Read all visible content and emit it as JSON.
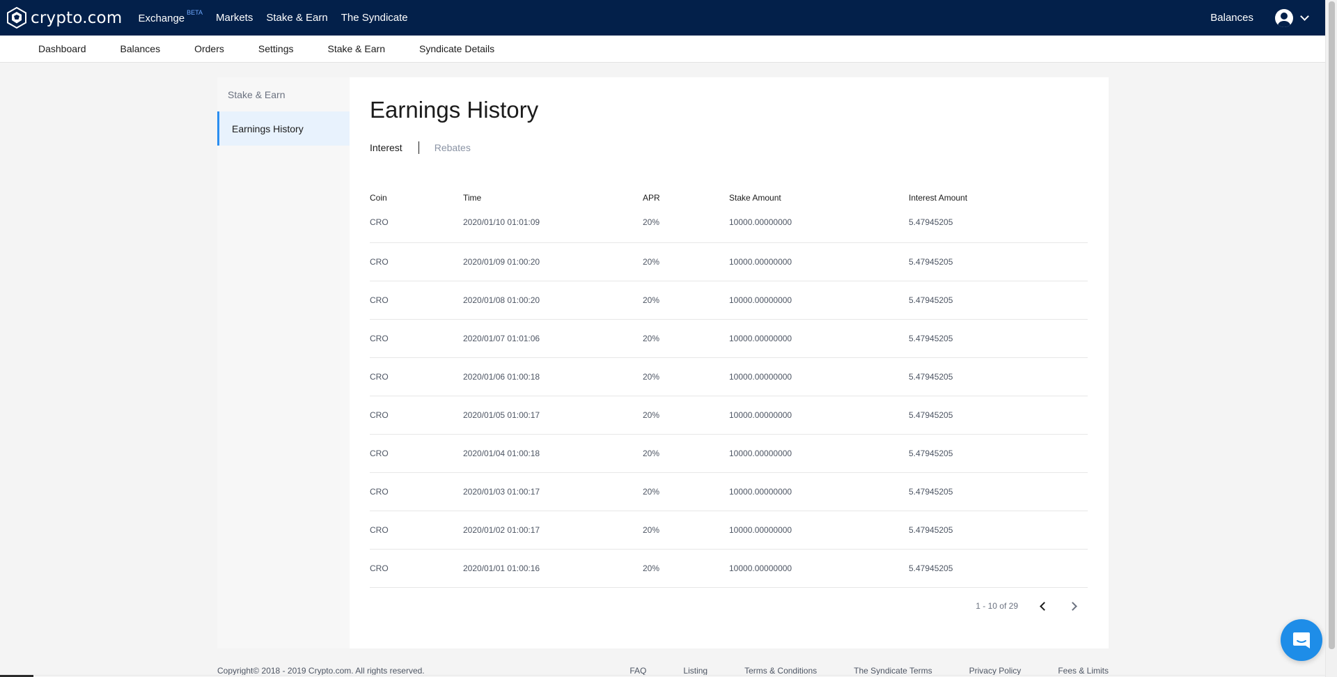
{
  "topbar": {
    "logo_text": "crypto.com",
    "nav": [
      {
        "label": "Exchange",
        "badge": "BETA"
      },
      {
        "label": "Markets"
      },
      {
        "label": "Stake & Earn"
      },
      {
        "label": "The Syndicate"
      }
    ],
    "balances_label": "Balances",
    "avatar_icon": "user-circle-icon",
    "menu_icon": "chevron-down-icon"
  },
  "subnav": [
    "Dashboard",
    "Balances",
    "Orders",
    "Settings",
    "Stake & Earn",
    "Syndicate Details"
  ],
  "sidebar": {
    "heading": "Stake & Earn",
    "items": [
      {
        "label": "Earnings History",
        "active": true
      }
    ]
  },
  "page": {
    "title": "Earnings History",
    "tabs": [
      {
        "label": "Interest",
        "active": true
      },
      {
        "label": "Rebates",
        "active": false
      }
    ]
  },
  "table": {
    "columns": [
      "Coin",
      "Time",
      "APR",
      "Stake Amount",
      "Interest Amount"
    ],
    "rows": [
      [
        "CRO",
        "2020/01/10 01:01:09",
        "20%",
        "10000.00000000",
        "5.47945205"
      ],
      [
        "CRO",
        "2020/01/09 01:00:20",
        "20%",
        "10000.00000000",
        "5.47945205"
      ],
      [
        "CRO",
        "2020/01/08 01:00:20",
        "20%",
        "10000.00000000",
        "5.47945205"
      ],
      [
        "CRO",
        "2020/01/07 01:01:06",
        "20%",
        "10000.00000000",
        "5.47945205"
      ],
      [
        "CRO",
        "2020/01/06 01:00:18",
        "20%",
        "10000.00000000",
        "5.47945205"
      ],
      [
        "CRO",
        "2020/01/05 01:00:17",
        "20%",
        "10000.00000000",
        "5.47945205"
      ],
      [
        "CRO",
        "2020/01/04 01:00:18",
        "20%",
        "10000.00000000",
        "5.47945205"
      ],
      [
        "CRO",
        "2020/01/03 01:00:17",
        "20%",
        "10000.00000000",
        "5.47945205"
      ],
      [
        "CRO",
        "2020/01/02 01:00:17",
        "20%",
        "10000.00000000",
        "5.47945205"
      ],
      [
        "CRO",
        "2020/01/01 01:00:16",
        "20%",
        "10000.00000000",
        "5.47945205"
      ]
    ]
  },
  "pagination": {
    "range_text": "1 - 10 of 29",
    "prev_icon": "chevron-left-icon",
    "next_icon": "chevron-right-icon"
  },
  "footer": {
    "copyright": "Copyright© 2018 - 2019 Crypto.com. All rights reserved.",
    "links": [
      "FAQ",
      "Listing",
      "Terms & Conditions",
      "The Syndicate Terms",
      "Privacy Policy",
      "Fees & Limits"
    ]
  },
  "chat": {
    "icon": "chat-bubble-icon"
  },
  "colors": {
    "navbar": "#03204a",
    "accent": "#2b8ef0",
    "active_side_bg": "#e8f2fd",
    "chat": "#1e8de8"
  }
}
